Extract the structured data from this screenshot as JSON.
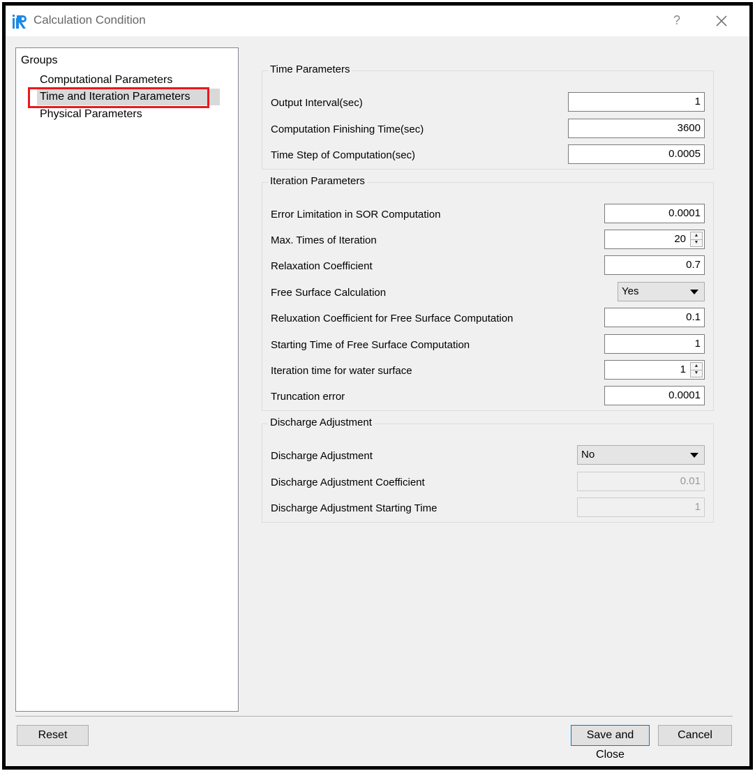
{
  "window": {
    "title": "Calculation Condition",
    "help": "?"
  },
  "groups": {
    "title": "Groups",
    "items": [
      {
        "label": "Computational Parameters"
      },
      {
        "label": "Time and Iteration Parameters"
      },
      {
        "label": "Physical Parameters"
      }
    ],
    "selected_index": 1
  },
  "time_parameters": {
    "title": "Time Parameters",
    "output_interval": {
      "label": "Output Interval(sec)",
      "value": "1"
    },
    "finishing_time": {
      "label": "Computation Finishing Time(sec)",
      "value": "3600"
    },
    "time_step": {
      "label": "Time Step of Computation(sec)",
      "value": "0.0005"
    }
  },
  "iteration_parameters": {
    "title": "Iteration Parameters",
    "error_limitation": {
      "label": "Error Limitation in SOR Computation",
      "value": "0.0001"
    },
    "max_iteration": {
      "label": "Max. Times of Iteration",
      "value": "20"
    },
    "relaxation": {
      "label": "Relaxation Coefficient",
      "value": "0.7"
    },
    "free_surface": {
      "label": "Free Surface Calculation",
      "value": "Yes"
    },
    "reluxation_free_surface": {
      "label": "Reluxation Coefficient for Free Surface Computation",
      "value": "0.1"
    },
    "starting_time_free_surface": {
      "label": "Starting Time of Free Surface Computation",
      "value": "1"
    },
    "iteration_water_surface": {
      "label": "Iteration time for water surface",
      "value": "1"
    },
    "truncation_error": {
      "label": "Truncation error",
      "value": "0.0001"
    }
  },
  "discharge_adjustment": {
    "title": "Discharge Adjustment",
    "enabled": {
      "label": "Discharge Adjustment",
      "value": "No"
    },
    "coefficient": {
      "label": "Discharge Adjustment Coefficient",
      "value": "0.01"
    },
    "starting_time": {
      "label": "Discharge Adjustment Starting Time",
      "value": "1"
    }
  },
  "buttons": {
    "reset": "Reset",
    "save_close": "Save and Close",
    "cancel": "Cancel"
  },
  "colors": {
    "highlight": "#e8191e",
    "logo_blue": "#1e88e5",
    "accent": "#0078d7"
  }
}
